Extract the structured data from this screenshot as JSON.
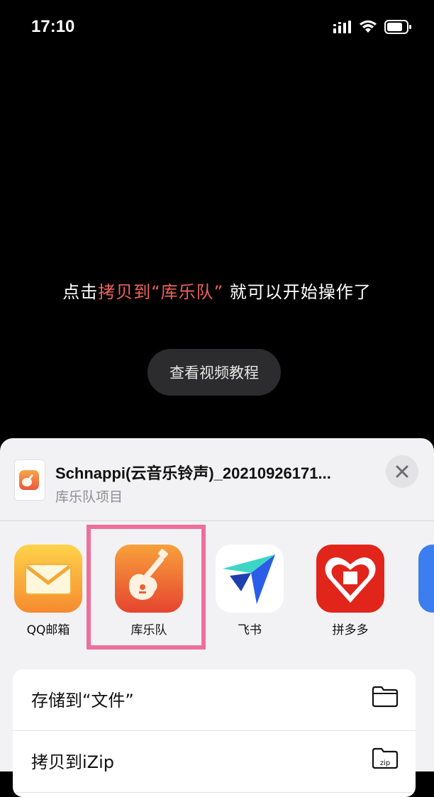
{
  "status_bar": {
    "time": "17:10",
    "icons": [
      "signal-icon",
      "wifi-icon",
      "battery-icon"
    ]
  },
  "video": {
    "instruction_prefix": "点击",
    "instruction_highlight": "拷贝到“库乐队”",
    "instruction_suffix": " 就可以开始操作了",
    "tutorial_button": "查看视频教程",
    "highlight_color": "#f0625a"
  },
  "share_sheet": {
    "file_name": "Schnappi(云音乐铃声)_20210926171...",
    "file_type": "库乐队项目",
    "close_icon": "close-icon",
    "apps": [
      {
        "label": "QQ邮箱",
        "icon": "mail-icon"
      },
      {
        "label": "库乐队",
        "icon": "guitar-icon"
      },
      {
        "label": "飞书",
        "icon": "paper-plane-icon"
      },
      {
        "label": "拼多多",
        "icon": "heart-icon"
      }
    ],
    "actions": [
      {
        "label": "存储到“文件”",
        "icon": "folder-icon"
      },
      {
        "label": "拷贝到iZip",
        "icon": "zip-folder-icon"
      }
    ],
    "selection_color": "#ee6f9a"
  }
}
